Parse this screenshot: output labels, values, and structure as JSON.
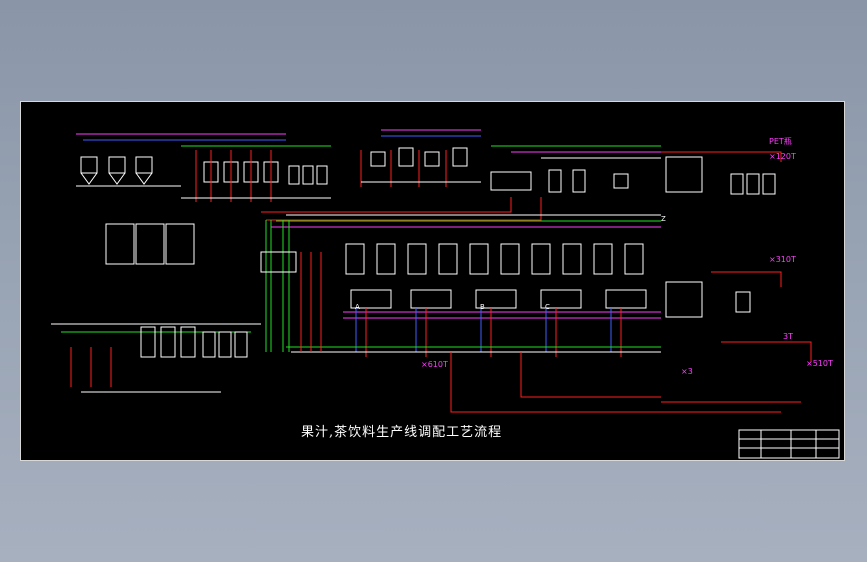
{
  "drawing": {
    "title": "果汁,茶饮料生产线调配工艺流程",
    "labels": {
      "pet_bottle": "PET瓶",
      "capacity_12t": "×120T",
      "capacity_3_10t": "×310T",
      "capacity_610t": "×610T",
      "capacity_510t": "×510T",
      "capacity_3t": "3T",
      "count_3": "×3",
      "z_label": "Z",
      "line_a": "A",
      "line_b": "B",
      "line_c": "C"
    },
    "colors": {
      "background": "#000000",
      "line_white": "#ffffff",
      "line_red": "#ff2020",
      "line_green": "#22e022",
      "line_magenta": "#ff3cff",
      "line_blue": "#4060ff",
      "line_cyan": "#00e0e0",
      "line_yellow": "#ffff00"
    }
  }
}
